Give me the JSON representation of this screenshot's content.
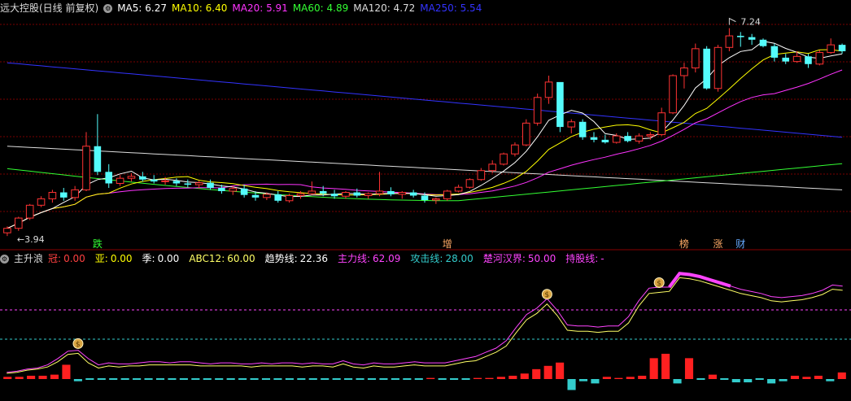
{
  "main_legend": {
    "title": "远大控股(日线 前复权)",
    "items": [
      {
        "label": "MA5: 6.27",
        "color": "#ffffff"
      },
      {
        "label": "MA10: 6.40",
        "color": "#ffff00"
      },
      {
        "label": "MA20: 5.91",
        "color": "#ff33ff"
      },
      {
        "label": "MA60: 4.89",
        "color": "#33ff33"
      },
      {
        "label": "MA120: 4.72",
        "color": "#dddddd"
      },
      {
        "label": "MA250: 5.54",
        "color": "#3333ff"
      }
    ]
  },
  "indicator_legend": {
    "title": "主升浪",
    "items": [
      {
        "key": "冠:",
        "value": "0.00",
        "key_color": "#ff4040",
        "value_color": "#ff4040"
      },
      {
        "key": "亚:",
        "value": "0.00",
        "key_color": "#ffff00",
        "value_color": "#ffff00"
      },
      {
        "key": "季:",
        "value": "0.00",
        "key_color": "#ffffff",
        "value_color": "#ffffff"
      },
      {
        "key": "ABC12:",
        "value": "60.00",
        "key_color": "#ffff66",
        "value_color": "#ffff66"
      },
      {
        "key": "趋势线:",
        "value": "22.36",
        "key_color": "#ffffff",
        "value_color": "#ffffff"
      },
      {
        "key": "主力线:",
        "value": "62.09",
        "key_color": "#ff44ff",
        "value_color": "#ff44ff"
      },
      {
        "key": "攻击线:",
        "value": "28.00",
        "key_color": "#33cccc",
        "value_color": "#33cccc"
      },
      {
        "key": "楚河汉界:",
        "value": "50.00",
        "key_color": "#ff44ff",
        "value_color": "#ff44ff"
      },
      {
        "key": "持股线:",
        "value": "-",
        "key_color": "#ff44ff",
        "value_color": "#ff44ff"
      }
    ]
  },
  "price_labels": {
    "high": "7.24",
    "low": "3.94"
  },
  "event_labels": [
    {
      "text": "跌",
      "color": "#33ff33",
      "x_index": 8
    },
    {
      "text": "增",
      "color": "#ffaa66",
      "x_index": 39
    },
    {
      "text": "榜",
      "color": "#ffaa66",
      "x_index": 60
    },
    {
      "text": "涨",
      "color": "#ffaa66",
      "x_index": 63
    },
    {
      "text": "财",
      "color": "#66aaff",
      "x_index": 65
    }
  ],
  "colors": {
    "up": "#ff3333",
    "down": "#54fcfc",
    "grid": "#7a0000",
    "ma5": "#ffffff",
    "ma10": "#ffff00",
    "ma20": "#ff33ff",
    "ma60": "#33ff33",
    "ma120": "#dddddd",
    "ma250": "#3333ff"
  },
  "chart_data": {
    "type": "candlestick",
    "candles": [
      [
        4.05,
        4.15,
        4.0,
        4.12
      ],
      [
        4.12,
        4.3,
        4.08,
        4.28
      ],
      [
        4.28,
        4.5,
        4.25,
        4.48
      ],
      [
        4.48,
        4.62,
        4.45,
        4.58
      ],
      [
        4.58,
        4.72,
        4.52,
        4.68
      ],
      [
        4.68,
        4.75,
        4.55,
        4.6
      ],
      [
        4.6,
        4.78,
        4.55,
        4.72
      ],
      [
        4.72,
        5.62,
        4.7,
        5.4
      ],
      [
        5.4,
        5.9,
        4.95,
        5.0
      ],
      [
        5.0,
        5.12,
        4.75,
        4.82
      ],
      [
        4.82,
        4.95,
        4.78,
        4.9
      ],
      [
        4.9,
        4.98,
        4.85,
        4.93
      ],
      [
        4.93,
        5.0,
        4.85,
        4.88
      ],
      [
        4.88,
        4.95,
        4.82,
        4.85
      ],
      [
        4.85,
        4.92,
        4.8,
        4.86
      ],
      [
        4.86,
        4.9,
        4.78,
        4.82
      ],
      [
        4.82,
        4.88,
        4.76,
        4.8
      ],
      [
        4.8,
        4.86,
        4.74,
        4.83
      ],
      [
        4.83,
        4.88,
        4.72,
        4.75
      ],
      [
        4.75,
        4.8,
        4.66,
        4.7
      ],
      [
        4.7,
        4.78,
        4.64,
        4.74
      ],
      [
        4.74,
        4.8,
        4.6,
        4.64
      ],
      [
        4.64,
        4.7,
        4.55,
        4.6
      ],
      [
        4.6,
        4.68,
        4.56,
        4.65
      ],
      [
        4.65,
        4.7,
        4.52,
        4.55
      ],
      [
        4.55,
        4.66,
        4.52,
        4.63
      ],
      [
        4.63,
        4.7,
        4.58,
        4.66
      ],
      [
        4.66,
        4.85,
        4.64,
        4.7
      ],
      [
        4.7,
        4.78,
        4.62,
        4.66
      ],
      [
        4.66,
        4.72,
        4.58,
        4.62
      ],
      [
        4.62,
        4.7,
        4.58,
        4.68
      ],
      [
        4.68,
        4.74,
        4.6,
        4.63
      ],
      [
        4.63,
        4.68,
        4.58,
        4.66
      ],
      [
        4.66,
        5.0,
        4.62,
        4.7
      ],
      [
        4.7,
        4.76,
        4.62,
        4.65
      ],
      [
        4.65,
        4.7,
        4.58,
        4.68
      ],
      [
        4.68,
        4.72,
        4.6,
        4.63
      ],
      [
        4.63,
        4.68,
        4.52,
        4.56
      ],
      [
        4.56,
        4.6,
        4.5,
        4.58
      ],
      [
        4.58,
        4.72,
        4.55,
        4.7
      ],
      [
        4.7,
        4.8,
        4.68,
        4.76
      ],
      [
        4.76,
        4.9,
        4.74,
        4.88
      ],
      [
        4.88,
        5.06,
        4.86,
        5.02
      ],
      [
        5.02,
        5.18,
        4.98,
        5.12
      ],
      [
        5.12,
        5.3,
        5.1,
        5.28
      ],
      [
        5.28,
        5.46,
        5.24,
        5.42
      ],
      [
        5.42,
        5.82,
        5.4,
        5.76
      ],
      [
        5.76,
        6.22,
        5.72,
        6.16
      ],
      [
        6.16,
        6.5,
        6.06,
        6.4
      ],
      [
        6.4,
        6.3,
        5.62,
        5.7
      ],
      [
        5.7,
        5.82,
        5.6,
        5.78
      ],
      [
        5.78,
        5.82,
        5.5,
        5.54
      ],
      [
        5.54,
        5.62,
        5.46,
        5.5
      ],
      [
        5.5,
        5.58,
        5.44,
        5.46
      ],
      [
        5.46,
        5.6,
        5.44,
        5.56
      ],
      [
        5.56,
        5.62,
        5.46,
        5.48
      ],
      [
        5.48,
        5.6,
        5.44,
        5.56
      ],
      [
        5.56,
        5.62,
        5.5,
        5.58
      ],
      [
        5.58,
        6.0,
        5.56,
        5.92
      ],
      [
        5.92,
        6.52,
        5.9,
        6.5
      ],
      [
        6.5,
        6.7,
        6.3,
        6.62
      ],
      [
        6.62,
        7.0,
        6.55,
        6.92
      ],
      [
        6.92,
        6.96,
        6.28,
        6.3
      ],
      [
        6.3,
        6.98,
        6.25,
        6.94
      ],
      [
        6.94,
        7.24,
        6.88,
        7.12
      ],
      [
        7.12,
        7.18,
        6.95,
        7.1
      ],
      [
        7.1,
        7.15,
        6.98,
        7.06
      ],
      [
        7.06,
        7.08,
        6.94,
        6.96
      ],
      [
        6.96,
        7.0,
        6.72,
        6.78
      ],
      [
        6.78,
        6.84,
        6.68,
        6.72
      ],
      [
        6.72,
        6.88,
        6.7,
        6.8
      ],
      [
        6.8,
        6.84,
        6.62,
        6.68
      ],
      [
        6.68,
        6.9,
        6.66,
        6.86
      ],
      [
        6.86,
        7.08,
        6.84,
        6.98
      ],
      [
        6.98,
        7.0,
        6.84,
        6.88
      ]
    ],
    "indicator": {
      "ylim": [
        -20,
        110
      ],
      "line_magenta": [
        5,
        6,
        8,
        9,
        12,
        18,
        25,
        26,
        18,
        12,
        14,
        13,
        13,
        14,
        15,
        15,
        14,
        15,
        15,
        14,
        13,
        14,
        14,
        13,
        13,
        14,
        13,
        14,
        14,
        13,
        14,
        13,
        13,
        16,
        13,
        12,
        14,
        13,
        13,
        14,
        15,
        14,
        14,
        14,
        16,
        18,
        20,
        24,
        28,
        35,
        48,
        60,
        66,
        75,
        64,
        50,
        49,
        49,
        48,
        49,
        49,
        58,
        73,
        85,
        86,
        86,
        99,
        98,
        96,
        93,
        90,
        87,
        84,
        82,
        80,
        77,
        76,
        77,
        78,
        80,
        83,
        88,
        87
      ],
      "line_yellow": [
        4,
        5,
        7,
        8,
        10,
        15,
        22,
        23,
        14,
        9,
        11,
        10,
        11,
        11,
        12,
        12,
        12,
        12,
        12,
        11,
        11,
        11,
        11,
        11,
        10,
        11,
        11,
        11,
        11,
        10,
        11,
        11,
        10,
        13,
        10,
        9,
        11,
        10,
        10,
        11,
        12,
        11,
        11,
        11,
        13,
        15,
        16,
        20,
        24,
        30,
        43,
        55,
        61,
        70,
        59,
        45,
        44,
        44,
        43,
        44,
        44,
        52,
        68,
        80,
        81,
        82,
        95,
        94,
        92,
        89,
        86,
        83,
        80,
        78,
        76,
        73,
        72,
        73,
        74,
        76,
        79,
        84,
        83
      ],
      "bars": [
        2,
        2,
        3,
        3,
        4,
        13,
        -2,
        0,
        0,
        0,
        0,
        0,
        0,
        0,
        0,
        0,
        0,
        0,
        0,
        0,
        0,
        0,
        0,
        0,
        0,
        0,
        0,
        0,
        0,
        0,
        0,
        0,
        0,
        0,
        0,
        0,
        1,
        0,
        0,
        0,
        1,
        1,
        2,
        3,
        5,
        9,
        12,
        15,
        -10,
        -2,
        -4,
        2,
        1,
        2,
        3,
        19,
        23,
        -4,
        19,
        0,
        4,
        0,
        -3,
        -3,
        0,
        -4,
        -2,
        3,
        2,
        3,
        -2,
        6
      ]
    }
  }
}
